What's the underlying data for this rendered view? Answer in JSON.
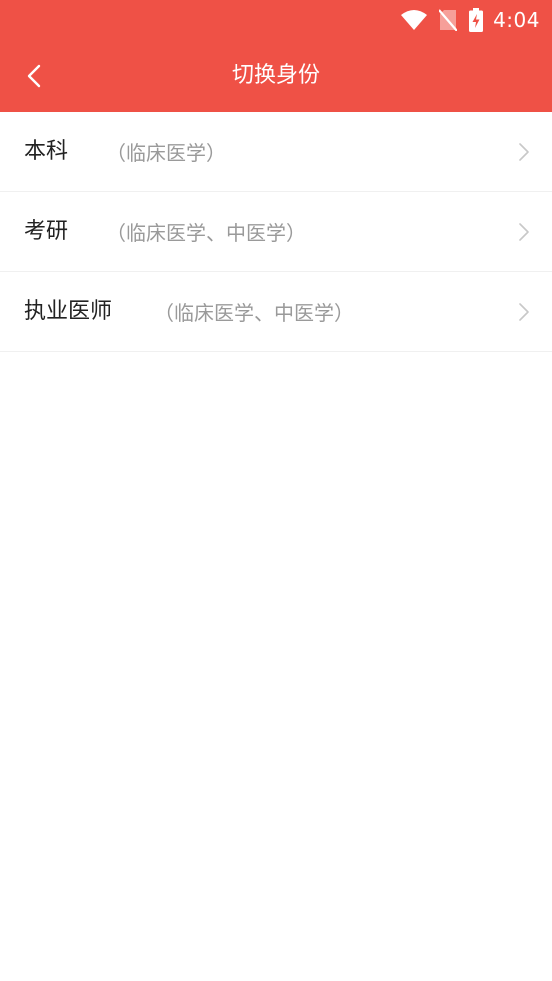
{
  "status_bar": {
    "time": "4:04",
    "icons": [
      "wifi-icon",
      "no-sim-icon",
      "battery-charging-icon"
    ]
  },
  "header": {
    "title": "切换身份",
    "back_icon": "chevron-left-icon",
    "background_color": "#ef5146"
  },
  "identities": [
    {
      "label": "本科",
      "detail": "（临床医学）"
    },
    {
      "label": "考研",
      "detail": "（临床医学、中医学）"
    },
    {
      "label": "执业医师",
      "detail": "（临床医学、中医学）"
    }
  ]
}
